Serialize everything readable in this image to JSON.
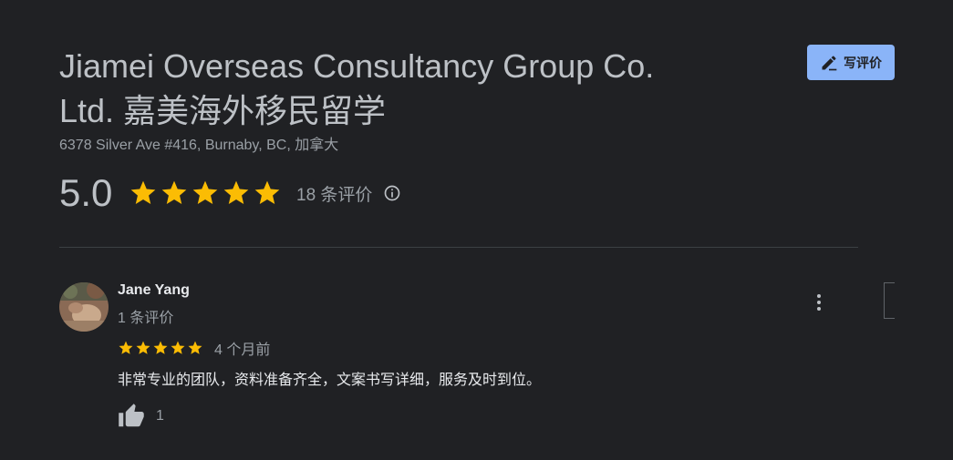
{
  "business": {
    "title": "Jiamei Overseas Consultancy Group Co. Ltd. 嘉美海外移民留学",
    "address": "6378 Silver Ave #416, Burnaby, BC, 加拿大"
  },
  "write_review": {
    "label": "写评价",
    "icon": "edit-pencil-icon"
  },
  "rating": {
    "value": "5.0",
    "stars": 5,
    "count_label": "18 条评价",
    "star_color": "#fbbc04"
  },
  "review": {
    "author": "Jane Yang",
    "author_reviews": "1 条评价",
    "stars": 5,
    "time": "4 个月前",
    "text": "非常专业的团队，资料准备齐全，文案书写详细，服务及时到位。",
    "likes": "1"
  },
  "colors": {
    "background": "#202124",
    "accent": "#8ab4f8",
    "text": "#bdc1c6"
  }
}
